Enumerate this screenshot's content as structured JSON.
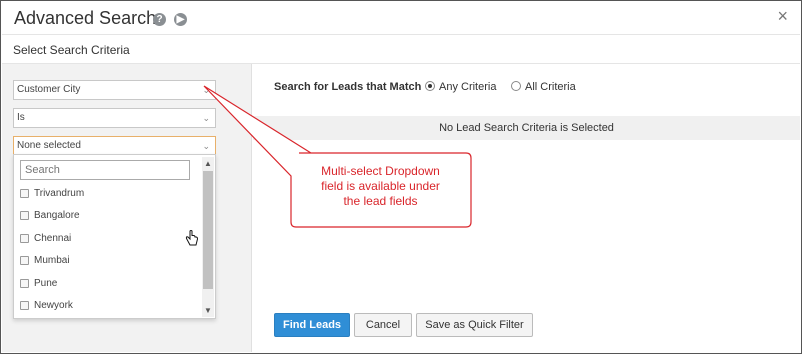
{
  "dialog": {
    "title": "Advanced Search",
    "subtitle": "Select Search Criteria",
    "close_symbol": "×"
  },
  "icons": {
    "help": "help-circle-icon",
    "play": "play-circle-icon",
    "close": "close-icon",
    "cursor": "hand-pointer-icon"
  },
  "criteria": {
    "field_select": "Customer City",
    "operator_select": "Is",
    "value_select": "None selected"
  },
  "dropdown": {
    "search_placeholder": "Search",
    "options": [
      "Trivandrum",
      "Bangalore",
      "Chennai",
      "Mumbai",
      "Pune",
      "Newyork"
    ]
  },
  "match": {
    "label": "Search for Leads that Match",
    "any": "Any Criteria",
    "all": "All Criteria",
    "selected": "Any Criteria"
  },
  "results": {
    "empty_message": "No Lead Search Criteria is Selected"
  },
  "buttons": {
    "find": "Find Leads",
    "cancel": "Cancel",
    "quick_filter": "Save as Quick Filter"
  },
  "callout": {
    "line1": "Multi-select Dropdown",
    "line2": "field is available under",
    "line3": "the lead fields"
  },
  "colors": {
    "primary_button": "#2f8ed6",
    "callout_text": "#d9252b",
    "callout_border": "#d9252b"
  }
}
